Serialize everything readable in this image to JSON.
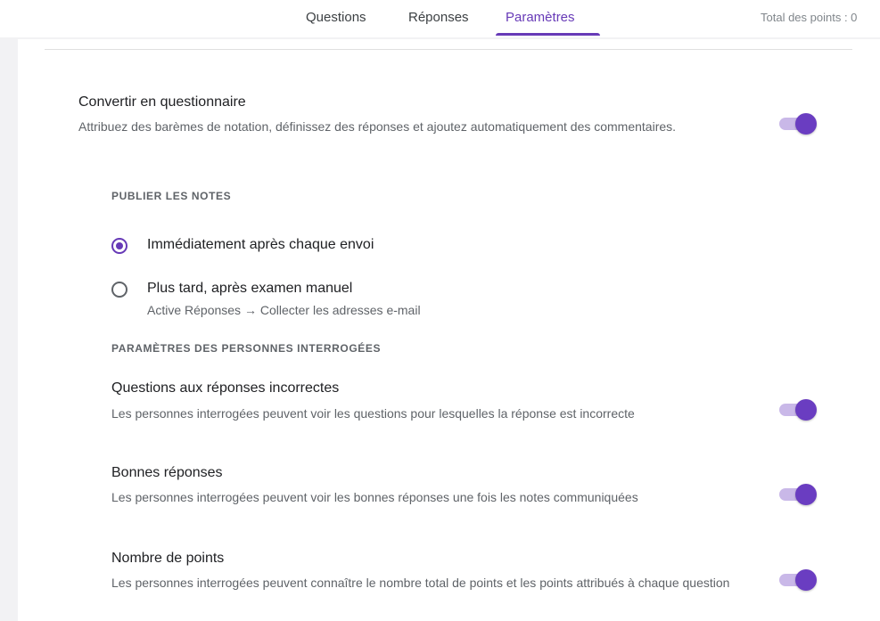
{
  "header": {
    "tabs": [
      {
        "label": "Questions",
        "active": false
      },
      {
        "label": "Réponses",
        "active": false
      },
      {
        "label": "Paramètres",
        "active": true
      }
    ],
    "total_points": "Total des points : 0"
  },
  "quiz": {
    "title": "Convertir en questionnaire",
    "description": "Attribuez des barèmes de notation, définissez des réponses et ajoutez automatiquement des commentaires.",
    "enabled": true
  },
  "publish_grades": {
    "heading": "PUBLIER LES NOTES",
    "options": [
      {
        "label": "Immédiatement après chaque envoi",
        "sub": "",
        "selected": true
      },
      {
        "label": "Plus tard, après examen manuel",
        "sub": "Active Réponses → Collecter les adresses e-mail",
        "selected": false
      }
    ]
  },
  "respondent_settings": {
    "heading": "PARAMÈTRES DES PERSONNES INTERROGÉES",
    "items": [
      {
        "title": "Questions aux réponses incorrectes",
        "description": "Les personnes interrogées peuvent voir les questions pour lesquelles la réponse est incorrecte",
        "enabled": true
      },
      {
        "title": "Bonnes réponses",
        "description": "Les personnes interrogées peuvent voir les bonnes réponses une fois les notes communiquées",
        "enabled": true
      },
      {
        "title": "Nombre de points",
        "description": "Les personnes interrogées peuvent connaître le nombre total de points et les points attribués à chaque question",
        "enabled": true
      }
    ]
  },
  "colors": {
    "accent": "#673ab7",
    "toggle_track": "#c9b8e8",
    "annotation_arrow": "#2f66b3"
  }
}
